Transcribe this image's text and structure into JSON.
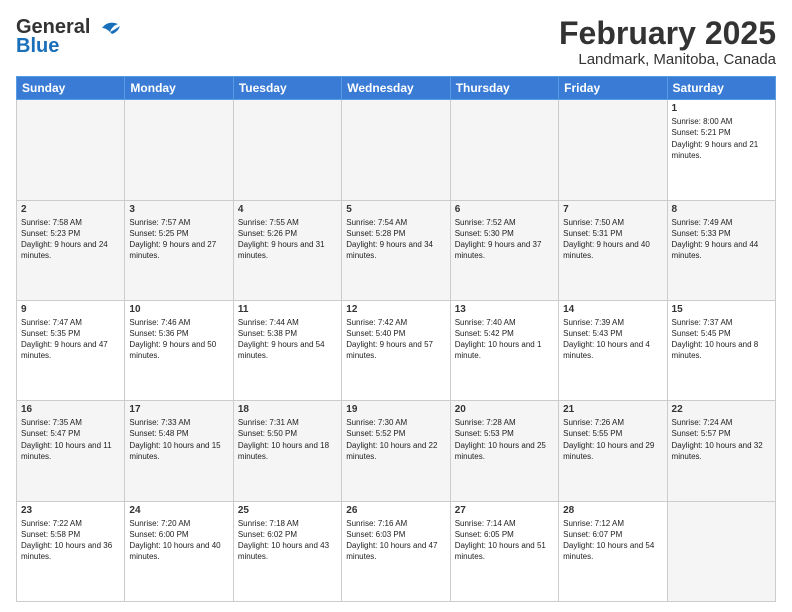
{
  "logo": {
    "general": "General",
    "blue": "Blue"
  },
  "title": {
    "month": "February 2025",
    "location": "Landmark, Manitoba, Canada"
  },
  "weekdays": [
    "Sunday",
    "Monday",
    "Tuesday",
    "Wednesday",
    "Thursday",
    "Friday",
    "Saturday"
  ],
  "weeks": [
    [
      {
        "day": "",
        "info": ""
      },
      {
        "day": "",
        "info": ""
      },
      {
        "day": "",
        "info": ""
      },
      {
        "day": "",
        "info": ""
      },
      {
        "day": "",
        "info": ""
      },
      {
        "day": "",
        "info": ""
      },
      {
        "day": "1",
        "info": "Sunrise: 8:00 AM\nSunset: 5:21 PM\nDaylight: 9 hours and 21 minutes."
      }
    ],
    [
      {
        "day": "2",
        "info": "Sunrise: 7:58 AM\nSunset: 5:23 PM\nDaylight: 9 hours and 24 minutes."
      },
      {
        "day": "3",
        "info": "Sunrise: 7:57 AM\nSunset: 5:25 PM\nDaylight: 9 hours and 27 minutes."
      },
      {
        "day": "4",
        "info": "Sunrise: 7:55 AM\nSunset: 5:26 PM\nDaylight: 9 hours and 31 minutes."
      },
      {
        "day": "5",
        "info": "Sunrise: 7:54 AM\nSunset: 5:28 PM\nDaylight: 9 hours and 34 minutes."
      },
      {
        "day": "6",
        "info": "Sunrise: 7:52 AM\nSunset: 5:30 PM\nDaylight: 9 hours and 37 minutes."
      },
      {
        "day": "7",
        "info": "Sunrise: 7:50 AM\nSunset: 5:31 PM\nDaylight: 9 hours and 40 minutes."
      },
      {
        "day": "8",
        "info": "Sunrise: 7:49 AM\nSunset: 5:33 PM\nDaylight: 9 hours and 44 minutes."
      }
    ],
    [
      {
        "day": "9",
        "info": "Sunrise: 7:47 AM\nSunset: 5:35 PM\nDaylight: 9 hours and 47 minutes."
      },
      {
        "day": "10",
        "info": "Sunrise: 7:46 AM\nSunset: 5:36 PM\nDaylight: 9 hours and 50 minutes."
      },
      {
        "day": "11",
        "info": "Sunrise: 7:44 AM\nSunset: 5:38 PM\nDaylight: 9 hours and 54 minutes."
      },
      {
        "day": "12",
        "info": "Sunrise: 7:42 AM\nSunset: 5:40 PM\nDaylight: 9 hours and 57 minutes."
      },
      {
        "day": "13",
        "info": "Sunrise: 7:40 AM\nSunset: 5:42 PM\nDaylight: 10 hours and 1 minute."
      },
      {
        "day": "14",
        "info": "Sunrise: 7:39 AM\nSunset: 5:43 PM\nDaylight: 10 hours and 4 minutes."
      },
      {
        "day": "15",
        "info": "Sunrise: 7:37 AM\nSunset: 5:45 PM\nDaylight: 10 hours and 8 minutes."
      }
    ],
    [
      {
        "day": "16",
        "info": "Sunrise: 7:35 AM\nSunset: 5:47 PM\nDaylight: 10 hours and 11 minutes."
      },
      {
        "day": "17",
        "info": "Sunrise: 7:33 AM\nSunset: 5:48 PM\nDaylight: 10 hours and 15 minutes."
      },
      {
        "day": "18",
        "info": "Sunrise: 7:31 AM\nSunset: 5:50 PM\nDaylight: 10 hours and 18 minutes."
      },
      {
        "day": "19",
        "info": "Sunrise: 7:30 AM\nSunset: 5:52 PM\nDaylight: 10 hours and 22 minutes."
      },
      {
        "day": "20",
        "info": "Sunrise: 7:28 AM\nSunset: 5:53 PM\nDaylight: 10 hours and 25 minutes."
      },
      {
        "day": "21",
        "info": "Sunrise: 7:26 AM\nSunset: 5:55 PM\nDaylight: 10 hours and 29 minutes."
      },
      {
        "day": "22",
        "info": "Sunrise: 7:24 AM\nSunset: 5:57 PM\nDaylight: 10 hours and 32 minutes."
      }
    ],
    [
      {
        "day": "23",
        "info": "Sunrise: 7:22 AM\nSunset: 5:58 PM\nDaylight: 10 hours and 36 minutes."
      },
      {
        "day": "24",
        "info": "Sunrise: 7:20 AM\nSunset: 6:00 PM\nDaylight: 10 hours and 40 minutes."
      },
      {
        "day": "25",
        "info": "Sunrise: 7:18 AM\nSunset: 6:02 PM\nDaylight: 10 hours and 43 minutes."
      },
      {
        "day": "26",
        "info": "Sunrise: 7:16 AM\nSunset: 6:03 PM\nDaylight: 10 hours and 47 minutes."
      },
      {
        "day": "27",
        "info": "Sunrise: 7:14 AM\nSunset: 6:05 PM\nDaylight: 10 hours and 51 minutes."
      },
      {
        "day": "28",
        "info": "Sunrise: 7:12 AM\nSunset: 6:07 PM\nDaylight: 10 hours and 54 minutes."
      },
      {
        "day": "",
        "info": ""
      }
    ]
  ]
}
